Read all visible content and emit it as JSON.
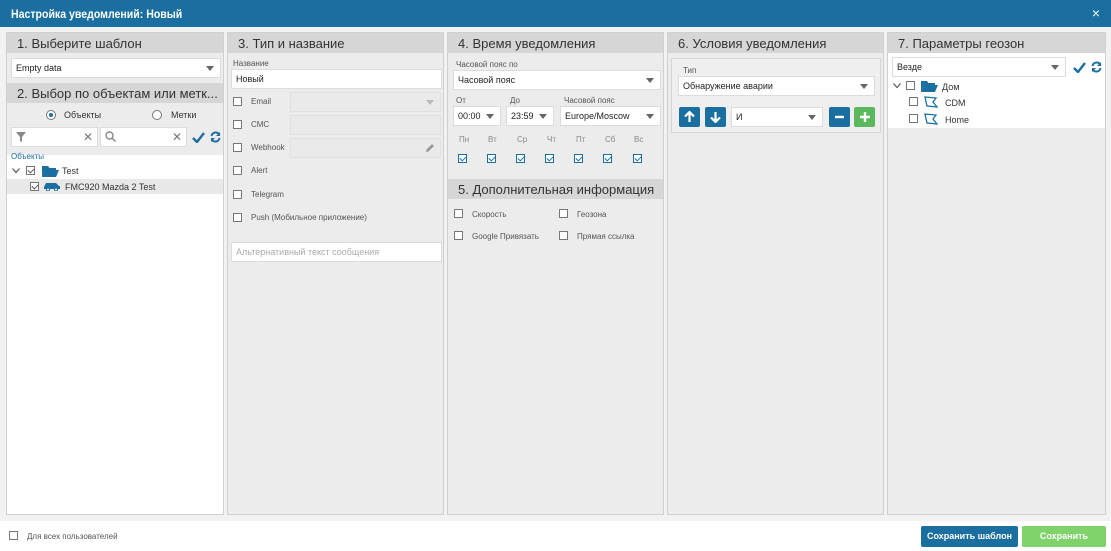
{
  "window": {
    "title": "Настройка уведомлений: Новый",
    "close": "×"
  },
  "template": {
    "header": "1. Выберите шаблон",
    "value": "Empty data"
  },
  "objects": {
    "header": "2. Выбор по объектам или метк...",
    "radio_objects": "Объекты",
    "radio_tags": "Метки",
    "section_label": "Объекты",
    "tree": [
      {
        "label": "Test",
        "checked": true
      },
      {
        "label": "FMC920 Mazda 2 Test",
        "checked": true
      }
    ]
  },
  "type_name": {
    "header": "3. Тип и название",
    "name_label": "Название",
    "name_value": "Новый",
    "channels": [
      "Email",
      "СМС",
      "Webhook",
      "Alert",
      "Telegram",
      "Push (Мобильное приложение)"
    ],
    "alt_placeholder": "Альтернативный текст сообщения"
  },
  "time": {
    "header": "4. Время уведомления",
    "tz_by_label": "Часовой пояс по",
    "tz_by_value": "Часовой пояс",
    "from_label": "От",
    "from_value": "00:00",
    "to_label": "До",
    "to_value": "23:59",
    "tz_label": "Часовой пояс",
    "tz_value": "Europe/Moscow",
    "days": [
      "Пн",
      "Вт",
      "Ср",
      "Чт",
      "Пт",
      "Сб",
      "Вс"
    ]
  },
  "extra": {
    "header": "5. Дополнительная информация",
    "options": [
      "Скорость",
      "Геозона",
      "Google Привязать",
      "Прямая ссылка"
    ]
  },
  "conditions": {
    "header": "6. Условия уведомления",
    "type_label": "Тип",
    "type_value": "Обнаружение аварии",
    "logic_value": "И"
  },
  "geofences": {
    "header": "7. Параметры геозон",
    "filter_value": "Везде",
    "tree": [
      "Дом",
      "CDM",
      "Home"
    ]
  },
  "footer": {
    "all_users": "Для всех пользователей",
    "save_template": "Сохранить шаблон",
    "save": "Сохранить"
  },
  "colors": {
    "primary": "#1a6fa0",
    "success": "#5cb85c",
    "save_disabled": "#7fd36a"
  }
}
